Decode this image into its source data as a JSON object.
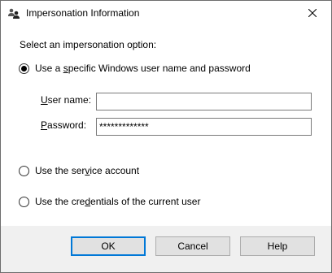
{
  "window": {
    "title": "Impersonation Information",
    "icon": "users-icon",
    "close_icon": "close-icon"
  },
  "content": {
    "section_label": "Select an impersonation option:",
    "options": [
      {
        "pre": "Use a ",
        "mnemonic": "s",
        "post": "pecific Windows user name and password",
        "checked": true
      },
      {
        "pre": "Use the ser",
        "mnemonic": "v",
        "post": "ice account",
        "checked": false
      },
      {
        "pre": "Use the cre",
        "mnemonic": "d",
        "post": "entials of the current user",
        "checked": false
      }
    ],
    "username": {
      "pre": "",
      "mnemonic": "U",
      "post": "ser name:",
      "value": ""
    },
    "password": {
      "pre": "",
      "mnemonic": "P",
      "post": "assword:",
      "value": "*************"
    }
  },
  "buttons": {
    "ok": "OK",
    "cancel": "Cancel",
    "help": "Help"
  },
  "colors": {
    "footer_bg": "#f0f0f0",
    "default_button_border": "#0078d7"
  }
}
